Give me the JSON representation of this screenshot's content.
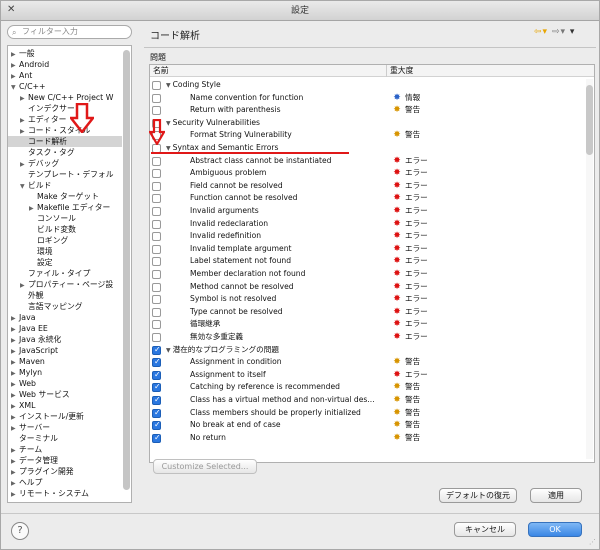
{
  "window": {
    "title": "設定"
  },
  "filter": {
    "placeholder": "フィルター入力"
  },
  "tree": [
    {
      "label": "一般",
      "depth": 0,
      "arrow": "▶"
    },
    {
      "label": "Android",
      "depth": 0,
      "arrow": "▶"
    },
    {
      "label": "Ant",
      "depth": 0,
      "arrow": "▶"
    },
    {
      "label": "C/C++",
      "depth": 0,
      "arrow": "▼"
    },
    {
      "label": "New C/C++ Project W",
      "depth": 1,
      "arrow": "▶"
    },
    {
      "label": "インデクサー",
      "depth": 1,
      "arrow": ""
    },
    {
      "label": "エディター",
      "depth": 1,
      "arrow": "▶"
    },
    {
      "label": "コード・スタイル",
      "depth": 1,
      "arrow": "▶"
    },
    {
      "label": "コード解析",
      "depth": 1,
      "arrow": "",
      "selected": true
    },
    {
      "label": "タスク・タグ",
      "depth": 1,
      "arrow": ""
    },
    {
      "label": "デバッグ",
      "depth": 1,
      "arrow": "▶"
    },
    {
      "label": "テンプレート・デフォル",
      "depth": 1,
      "arrow": ""
    },
    {
      "label": "ビルド",
      "depth": 1,
      "arrow": "▼"
    },
    {
      "label": "Make ターゲット",
      "depth": 2,
      "arrow": ""
    },
    {
      "label": "Makefile エディター",
      "depth": 2,
      "arrow": "▶"
    },
    {
      "label": "コンソール",
      "depth": 2,
      "arrow": ""
    },
    {
      "label": "ビルド変数",
      "depth": 2,
      "arrow": ""
    },
    {
      "label": "ロギング",
      "depth": 2,
      "arrow": ""
    },
    {
      "label": "環境",
      "depth": 2,
      "arrow": ""
    },
    {
      "label": "設定",
      "depth": 2,
      "arrow": ""
    },
    {
      "label": "ファイル・タイプ",
      "depth": 1,
      "arrow": ""
    },
    {
      "label": "プロパティー・ページ設",
      "depth": 1,
      "arrow": "▶"
    },
    {
      "label": "外観",
      "depth": 1,
      "arrow": ""
    },
    {
      "label": "言語マッピング",
      "depth": 1,
      "arrow": ""
    },
    {
      "label": "Java",
      "depth": 0,
      "arrow": "▶"
    },
    {
      "label": "Java EE",
      "depth": 0,
      "arrow": "▶"
    },
    {
      "label": "Java 永続化",
      "depth": 0,
      "arrow": "▶"
    },
    {
      "label": "JavaScript",
      "depth": 0,
      "arrow": "▶"
    },
    {
      "label": "Maven",
      "depth": 0,
      "arrow": "▶"
    },
    {
      "label": "Mylyn",
      "depth": 0,
      "arrow": "▶"
    },
    {
      "label": "Web",
      "depth": 0,
      "arrow": "▶"
    },
    {
      "label": "Web サービス",
      "depth": 0,
      "arrow": "▶"
    },
    {
      "label": "XML",
      "depth": 0,
      "arrow": "▶"
    },
    {
      "label": "インストール/更新",
      "depth": 0,
      "arrow": "▶"
    },
    {
      "label": "サーバー",
      "depth": 0,
      "arrow": "▶"
    },
    {
      "label": "ターミナル",
      "depth": 0,
      "arrow": ""
    },
    {
      "label": "チーム",
      "depth": 0,
      "arrow": "▶"
    },
    {
      "label": "データ管理",
      "depth": 0,
      "arrow": "▶"
    },
    {
      "label": "プラグイン開発",
      "depth": 0,
      "arrow": "▶"
    },
    {
      "label": "ヘルプ",
      "depth": 0,
      "arrow": "▶"
    },
    {
      "label": "リモート・システム",
      "depth": 0,
      "arrow": "▶"
    }
  ],
  "page": {
    "title": "コード解析",
    "problems_label": "問題"
  },
  "table": {
    "col_name": "名前",
    "col_severity": "重大度",
    "rows": [
      {
        "type": "cat",
        "name": "Coding Style",
        "checked": false
      },
      {
        "type": "item",
        "name": "Name convention for function",
        "severity": "情報",
        "icon": "info",
        "checked": false
      },
      {
        "type": "item",
        "name": "Return with parenthesis",
        "severity": "警告",
        "icon": "warn",
        "checked": false
      },
      {
        "type": "cat",
        "name": "Security Vulnerabilities",
        "checked": false
      },
      {
        "type": "item",
        "name": "Format String Vulnerability",
        "severity": "警告",
        "icon": "warn",
        "checked": false
      },
      {
        "type": "cat",
        "name": "Syntax and Semantic Errors",
        "checked": false
      },
      {
        "type": "item",
        "name": "Abstract class cannot be instantiated",
        "severity": "エラー",
        "icon": "err",
        "checked": false
      },
      {
        "type": "item",
        "name": "Ambiguous problem",
        "severity": "エラー",
        "icon": "err",
        "checked": false
      },
      {
        "type": "item",
        "name": "Field cannot be resolved",
        "severity": "エラー",
        "icon": "err",
        "checked": false
      },
      {
        "type": "item",
        "name": "Function cannot be resolved",
        "severity": "エラー",
        "icon": "err",
        "checked": false
      },
      {
        "type": "item",
        "name": "Invalid arguments",
        "severity": "エラー",
        "icon": "err",
        "checked": false
      },
      {
        "type": "item",
        "name": "Invalid redeclaration",
        "severity": "エラー",
        "icon": "err",
        "checked": false
      },
      {
        "type": "item",
        "name": "Invalid redefinition",
        "severity": "エラー",
        "icon": "err",
        "checked": false
      },
      {
        "type": "item",
        "name": "Invalid template argument",
        "severity": "エラー",
        "icon": "err",
        "checked": false
      },
      {
        "type": "item",
        "name": "Label statement not found",
        "severity": "エラー",
        "icon": "err",
        "checked": false
      },
      {
        "type": "item",
        "name": "Member declaration not found",
        "severity": "エラー",
        "icon": "err",
        "checked": false
      },
      {
        "type": "item",
        "name": "Method cannot be resolved",
        "severity": "エラー",
        "icon": "err",
        "checked": false
      },
      {
        "type": "item",
        "name": "Symbol is not resolved",
        "severity": "エラー",
        "icon": "err",
        "checked": false
      },
      {
        "type": "item",
        "name": "Type cannot be resolved",
        "severity": "エラー",
        "icon": "err",
        "checked": false
      },
      {
        "type": "item",
        "name": "循環継承",
        "severity": "エラー",
        "icon": "err",
        "checked": false
      },
      {
        "type": "item",
        "name": "無効な多重定義",
        "severity": "エラー",
        "icon": "err",
        "checked": false
      },
      {
        "type": "cat",
        "name": "潜在的なプログラミングの問題",
        "checked": true
      },
      {
        "type": "item",
        "name": "Assignment in condition",
        "severity": "警告",
        "icon": "warn",
        "checked": true
      },
      {
        "type": "item",
        "name": "Assignment to itself",
        "severity": "エラー",
        "icon": "err",
        "checked": true
      },
      {
        "type": "item",
        "name": "Catching by reference is recommended",
        "severity": "警告",
        "icon": "warn",
        "checked": true
      },
      {
        "type": "item",
        "name": "Class has a virtual method and non-virtual des...",
        "severity": "警告",
        "icon": "warn",
        "checked": true
      },
      {
        "type": "item",
        "name": "Class members should be properly initialized",
        "severity": "警告",
        "icon": "warn",
        "checked": true
      },
      {
        "type": "item",
        "name": "No break at end of case",
        "severity": "警告",
        "icon": "warn",
        "checked": true
      },
      {
        "type": "item",
        "name": "No return",
        "severity": "警告",
        "icon": "warn",
        "checked": true
      }
    ]
  },
  "buttons": {
    "customize": "Customize Selected...",
    "defaults": "デフォルトの復元",
    "apply": "適用",
    "cancel": "キャンセル",
    "ok": "OK"
  },
  "colors": {
    "annotation": "#e01818",
    "ok_button": "#3a86e5"
  }
}
